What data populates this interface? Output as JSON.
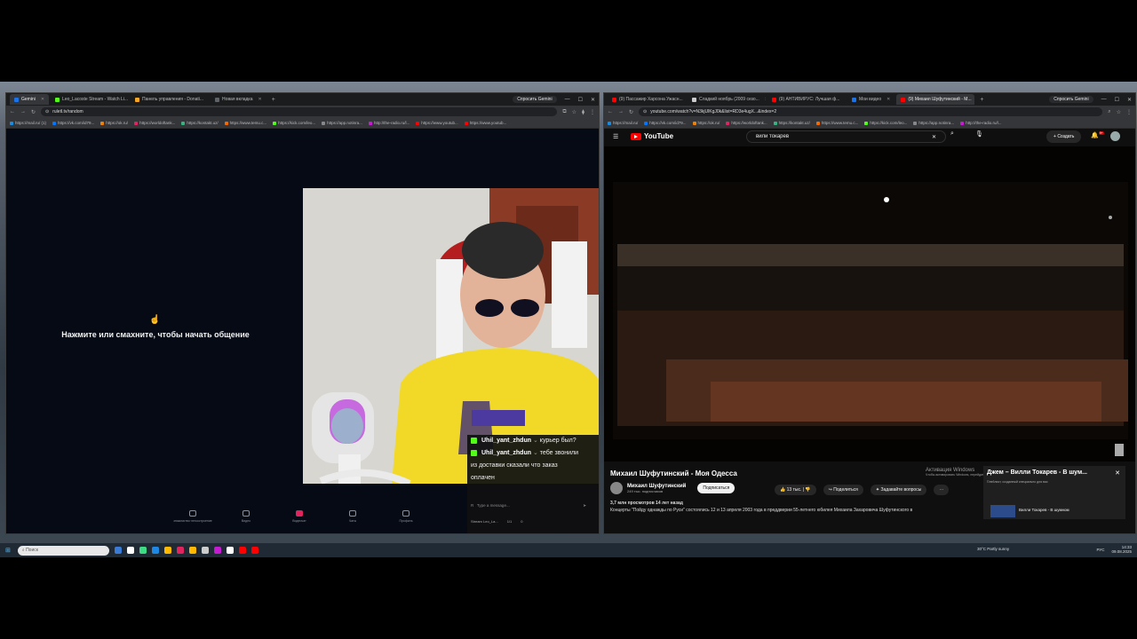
{
  "left_window": {
    "tabs": [
      {
        "label": "Gemini",
        "color": "#1a73e8",
        "active": true
      },
      {
        "label": "Leo_Lacoste Stream - Watch Li...",
        "color": "#53fc18",
        "active": false
      },
      {
        "label": "Панель управления - Donati...",
        "color": "#f5a623",
        "active": false
      },
      {
        "label": "Новая вкладка",
        "color": "#5f6368",
        "active": false
      }
    ],
    "gemini_label": "Спросить Gemini",
    "url": "ruletl.tv/random",
    "bookmarks": [
      {
        "label": "https://mail.ru/ (1)",
        "color": "#168de2"
      },
      {
        "label": "https://vk.com/id79...",
        "color": "#0077ff"
      },
      {
        "label": "https://ok.ru/",
        "color": "#ee8208"
      },
      {
        "label": "https://worldoftank...",
        "color": "#e0245e"
      },
      {
        "label": "https://kontakt.uz/",
        "color": "#36b37e"
      },
      {
        "label": "https://www.temu.c...",
        "color": "#f56a00"
      },
      {
        "label": "https://kick.com/leo...",
        "color": "#53fc18"
      },
      {
        "label": "https://app.notinra...",
        "color": "#888888"
      },
      {
        "label": "http://the-radio.ru/l...",
        "color": "#c51cd1"
      },
      {
        "label": "https://www.youtub...",
        "color": "#ff0000"
      },
      {
        "label": "https://www.youtub...",
        "color": "#ff0000"
      }
    ],
    "start_text": "Нажмите или смахните, чтобы начать общение",
    "bottom_nav": [
      {
        "label": "знакомство·легкостроение",
        "active": false
      },
      {
        "label": "Видео",
        "active": false
      },
      {
        "label": "Видеочат",
        "active": true
      },
      {
        "label": "Чаты",
        "active": false
      },
      {
        "label": "Профиль",
        "active": false
      }
    ],
    "chat": {
      "messages": [
        {
          "user": "Uhil_yant_zhdun",
          "text": "курьер был?"
        },
        {
          "user": "Uhil_yant_zhdun",
          "text": "тебе звонили"
        }
      ],
      "continuation": [
        "из доставки сказали что заказ",
        "оплачен"
      ],
      "input_placeholder": "Type a message...",
      "footer_left": "Stream Leo_La...",
      "footer_mid": "1/1",
      "footer_right": "0"
    }
  },
  "right_window": {
    "tabs": [
      {
        "label": "(9) Пассажир Харсона Ужасн...",
        "color": "#ff0000",
        "active": false
      },
      {
        "label": "Сладкий ноябрь (2009 сезо...",
        "color": "#cccccc",
        "active": false
      },
      {
        "label": "(9) АНТИВИРУС: Лучшая ф...",
        "color": "#ff0000",
        "active": false
      },
      {
        "label": "Мои видео",
        "color": "#1a73e8",
        "active": false
      },
      {
        "label": "(9) Михаил Шуфутинский - М...",
        "color": "#ff0000",
        "active": true
      }
    ],
    "gemini_label": "Спросить Gemini",
    "url": "youtube.com/watch?v=N3kjUlKgJ0k&list=RD3e4ugX...&index=2",
    "bookmarks": [
      {
        "label": "https://mail.ru/",
        "color": "#168de2"
      },
      {
        "label": "https://vk.com/id79...",
        "color": "#0077ff"
      },
      {
        "label": "https://ok.ru/",
        "color": "#ee8208"
      },
      {
        "label": "https://worldoftank...",
        "color": "#e0245e"
      },
      {
        "label": "https://kontakt.uz/",
        "color": "#36b37e"
      },
      {
        "label": "https://www.temu.c...",
        "color": "#f56a00"
      },
      {
        "label": "https://kick.com/leo...",
        "color": "#53fc18"
      },
      {
        "label": "https://app.notinra...",
        "color": "#888888"
      },
      {
        "label": "http://the-radio.ru/l...",
        "color": "#c51cd1"
      }
    ],
    "youtube": {
      "logo": "YouTube",
      "search_value": "вили токарев",
      "create_label": "Создать",
      "notification_count": "9+",
      "video_title": "Михаил Шуфутинский - Моя Одесса",
      "channel_name": "Михаил Шуфутинский",
      "channel_subs": "249 тыс. подписчиков",
      "subscribe_label": "Подписаться",
      "likes": "13 тыс.",
      "share_label": "Поделиться",
      "ask_label": "Задавайте вопросы",
      "views_line": "3,7 млн просмотров  14 лет назад",
      "description": "Концерты \"Пойду однажды по Руси\" состоялись 12 и 13 апреля 2003 года в преддверии 55-летнего юбилея Михаила Захаровича Шуфутинского в",
      "miniplayer": {
        "title": "Джем – Вилли Токарев - В шум...",
        "subtitle": "Плейлист, созданный специально для вас",
        "next": "Вилли Токарев - В шумном"
      },
      "activation_title": "Активация Windows",
      "activation_sub": "Чтобы активировать Windows, перейдите в раздел \"Параметры\"."
    }
  },
  "taskbar": {
    "search_placeholder": "Поиск",
    "weather": "30°C  Partly sunny",
    "lang": "РУС",
    "time": "14:33",
    "date": "09.08.2025",
    "apps": [
      "#3a7bd5",
      "#ffffff",
      "#3ddc84",
      "#1e88e5",
      "#ffb900",
      "#e0245e",
      "#ffb900",
      "#cccccc",
      "#c51cd1",
      "#ffffff",
      "#ff0000",
      "#ff0000"
    ]
  }
}
